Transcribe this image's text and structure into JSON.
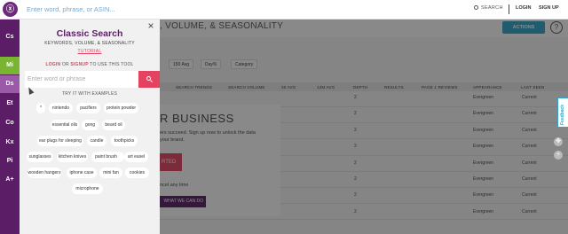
{
  "topbar": {
    "logo_text": "ⓧ",
    "search_placeholder": "Enter word, phrase, or ASIN...",
    "search_label": "SEARCH",
    "login": "LOGIN",
    "signup": "SIGN UP"
  },
  "rail": {
    "items": [
      "Cs",
      "Mi",
      "Ds",
      "Et",
      "Co",
      "Kx",
      "Pi",
      "A+"
    ]
  },
  "background": {
    "page_title": ", VOLUME, & SEASONALITY",
    "actions": "ACTIONS",
    "help": "?",
    "filters": [
      "150 Avg",
      "Day%",
      "Category"
    ],
    "table_headers": [
      "SEARCH TRENDS",
      "SEARCH VOLUME",
      "30 AVG",
      "12M AVG",
      "DEPTH",
      "RESULTS",
      "PAGE 1 REVIEWS",
      "APPEARANCE",
      "LAST SEEN"
    ],
    "rows": [
      {
        "depth": "2",
        "appearance": "Evergreen",
        "last_seen": "Current"
      },
      {
        "depth": "2",
        "appearance": "Evergreen",
        "last_seen": "Current"
      },
      {
        "depth": "2",
        "appearance": "Evergreen",
        "last_seen": "Current"
      },
      {
        "depth": "2",
        "appearance": "Evergreen",
        "last_seen": "Current"
      },
      {
        "depth": "2",
        "appearance": "Evergreen",
        "last_seen": "Current"
      },
      {
        "depth": "2",
        "appearance": "Evergreen",
        "last_seen": "Current"
      },
      {
        "depth": "2",
        "appearance": "Evergreen",
        "last_seen": "Current"
      },
      {
        "depth": "2",
        "appearance": "Evergreen",
        "last_seen": "Current"
      }
    ],
    "promo_title": "R BUSINESS",
    "promo_line1": "ers succeed. Sign up now to unlock the data",
    "promo_line2": "your brand.",
    "promo_cta": "RTED",
    "promo_small": "ncel any time",
    "promo_link": "WHAT WE CAN DO",
    "feedback": "Feedback"
  },
  "panel": {
    "close": "×",
    "title": "Classic Search",
    "subtitle": "KEYWORDS, VOLUME, & SEASONALITY",
    "tutorial": "TUTORIAL",
    "login": "LOGIN",
    "or": " OR ",
    "signup": "SIGNUP",
    "login_suffix": " TO USE THIS TOOL",
    "input_placeholder": "Enter word or phrase",
    "examples_label": "TRY IT WITH EXAMPLES",
    "examples": [
      "*",
      "nintendo",
      "pacifiers",
      "protein powder",
      "essential oils",
      "gong",
      "beard oil",
      "ear plugs for sleeping",
      "candle",
      "toothpicks",
      "sunglasses",
      "kitchen knives",
      "paint brush",
      "art easel",
      "wooden hangers",
      "iphone case",
      "mini fan",
      "cookies",
      "microphone"
    ]
  },
  "colors": {
    "brand_purple": "#5b1d66",
    "accent_pink": "#e34360",
    "active_green": "#7ab531",
    "action_blue": "#2ea5c9"
  }
}
